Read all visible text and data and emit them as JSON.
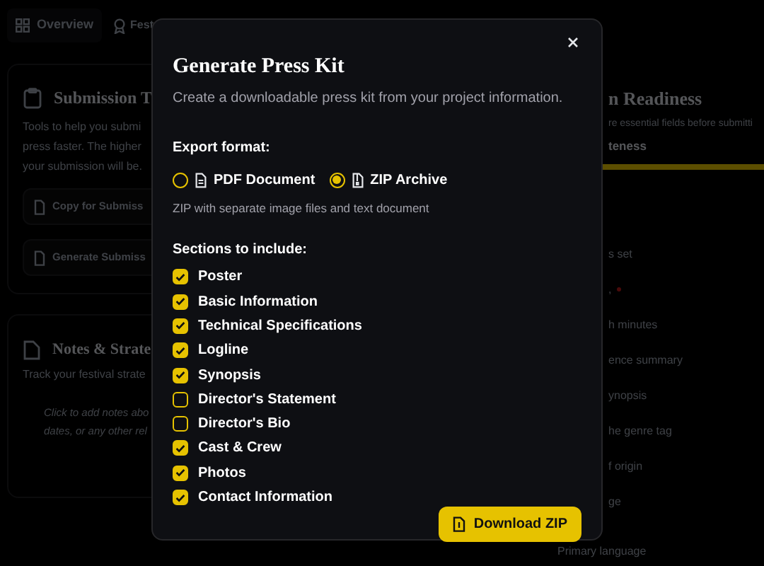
{
  "background": {
    "tabs": [
      {
        "label": "Overview",
        "selected": true
      },
      {
        "label": "Fest",
        "selected": false
      }
    ],
    "tools_card": {
      "title": "Submission T",
      "description_lines": [
        "Tools to help you submi",
        "press faster. The higher",
        "your submission will be."
      ],
      "buttons": [
        "Copy for Submiss",
        "Generate Submiss"
      ]
    },
    "notes_card": {
      "title": "Notes & Strate",
      "description": "Track your festival strate",
      "placeholder_lines": [
        "Click to add notes abo",
        "dates, or any other rel"
      ]
    },
    "readiness": {
      "title": "n Readiness",
      "description": "re essential fields before submitti",
      "progress_label": "teness",
      "level": 1,
      "items": [
        {
          "text": "s set",
          "required": false
        },
        {
          "text": ",",
          "required": true
        },
        {
          "text": "h minutes",
          "required": false
        },
        {
          "text": "ence summary",
          "required": false
        },
        {
          "text": "ynopsis",
          "required": false
        },
        {
          "text": "he genre tag",
          "required": false
        },
        {
          "text": "f origin",
          "required": false
        },
        {
          "text": "ge",
          "required": false
        },
        {
          "text": "Primary language",
          "required": false
        }
      ]
    }
  },
  "dialog": {
    "title": "Generate Press Kit",
    "subtitle": "Create a downloadable press kit from your project information.",
    "format_label": "Export format:",
    "formats": [
      {
        "label": "PDF Document",
        "selected": false,
        "kind": "pdf"
      },
      {
        "label": "ZIP Archive",
        "selected": true,
        "kind": "zip"
      }
    ],
    "format_hint": "ZIP with separate image files and text document",
    "sections_label": "Sections to include:",
    "sections": [
      {
        "label": "Poster",
        "checked": true
      },
      {
        "label": "Basic Information",
        "checked": true
      },
      {
        "label": "Technical Specifications",
        "checked": true
      },
      {
        "label": "Logline",
        "checked": true
      },
      {
        "label": "Synopsis",
        "checked": true
      },
      {
        "label": "Director's Statement",
        "checked": false
      },
      {
        "label": "Director's Bio",
        "checked": false
      },
      {
        "label": "Cast & Crew",
        "checked": true
      },
      {
        "label": "Photos",
        "checked": true
      },
      {
        "label": "Contact Information",
        "checked": true
      }
    ],
    "action": "Download ZIP"
  }
}
